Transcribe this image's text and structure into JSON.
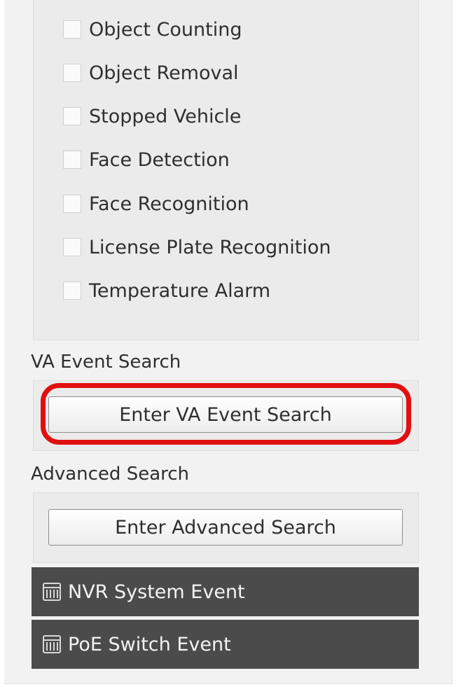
{
  "vca_types": [
    {
      "label": "Object Counting",
      "checked": false
    },
    {
      "label": "Object Removal",
      "checked": false
    },
    {
      "label": "Stopped Vehicle",
      "checked": false
    },
    {
      "label": "Face Detection",
      "checked": false
    },
    {
      "label": "Face Recognition",
      "checked": false
    },
    {
      "label": "License Plate Recognition",
      "checked": false
    },
    {
      "label": "Temperature Alarm",
      "checked": false
    }
  ],
  "va_event_search": {
    "title": "VA Event Search",
    "button_label": "Enter VA Event Search",
    "highlight_color": "#e01010"
  },
  "advanced_search": {
    "title": "Advanced Search",
    "button_label": "Enter Advanced Search"
  },
  "event_sections": [
    {
      "label": "NVR System Event",
      "icon": "calendar-icon"
    },
    {
      "label": "PoE Switch Event",
      "icon": "calendar-icon"
    }
  ]
}
